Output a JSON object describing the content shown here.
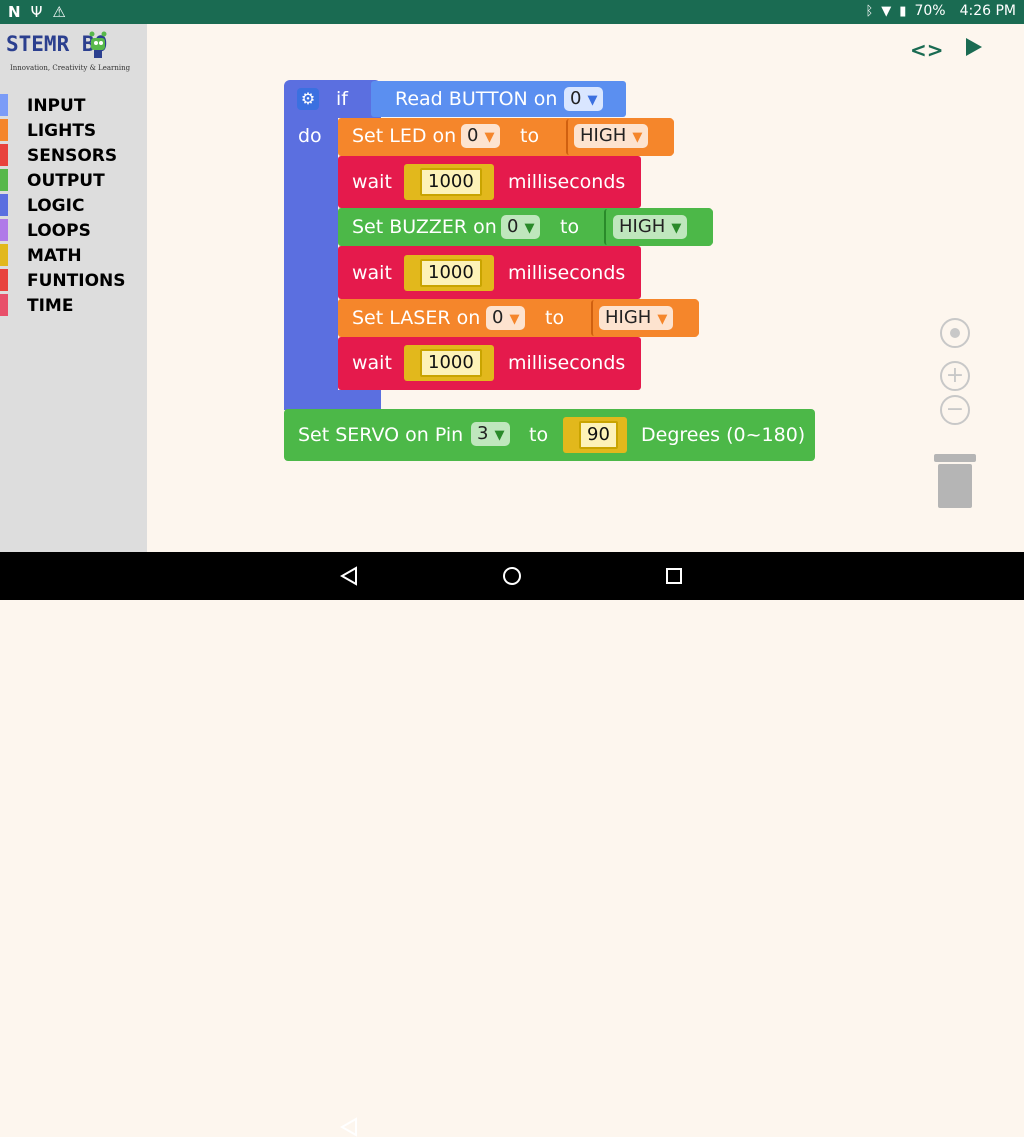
{
  "statusbar": {
    "battery": "70%",
    "time": "4:26 PM"
  },
  "logo": {
    "brand": "STEMR BO",
    "tagline": "Innovation, Creativity & Learning"
  },
  "sidebar": {
    "items": [
      {
        "label": "INPUT",
        "color": "#7b9cf7"
      },
      {
        "label": "LIGHTS",
        "color": "#f5862b"
      },
      {
        "label": "SENSORS",
        "color": "#e8423c"
      },
      {
        "label": "OUTPUT",
        "color": "#57b84b"
      },
      {
        "label": "LOGIC",
        "color": "#5b6fe0"
      },
      {
        "label": "LOOPS",
        "color": "#b07ae8"
      },
      {
        "label": "MATH",
        "color": "#e2b81c"
      },
      {
        "label": "FUNTIONS",
        "color": "#e8423c"
      },
      {
        "label": "TIME",
        "color": "#e8506a"
      }
    ]
  },
  "blocks": {
    "if_label": "if",
    "do_label": "do",
    "read_button": "Read BUTTON on",
    "read_button_pin": "0",
    "led_label": "Set LED on",
    "led_pin": "0",
    "to_label": "to",
    "led_value": "HIGH",
    "wait_label": "wait",
    "wait_value": "1000",
    "ms_label": "milliseconds",
    "buzzer_label": "Set BUZZER on",
    "buzzer_pin": "0",
    "buzzer_value": "HIGH",
    "laser_label": "Set LASER on",
    "laser_pin": "0",
    "laser_value": "HIGH",
    "servo_label": "Set SERVO on Pin",
    "servo_pin": "3",
    "servo_value": "90",
    "degrees_label": "Degrees (0~180)"
  },
  "colors": {
    "statusbar": "#1a6b52",
    "logic": "#5b6fe0",
    "lights": "#f5862b",
    "time": "#e51a4c",
    "output": "#4cb848",
    "input": "#5b8ff0"
  }
}
